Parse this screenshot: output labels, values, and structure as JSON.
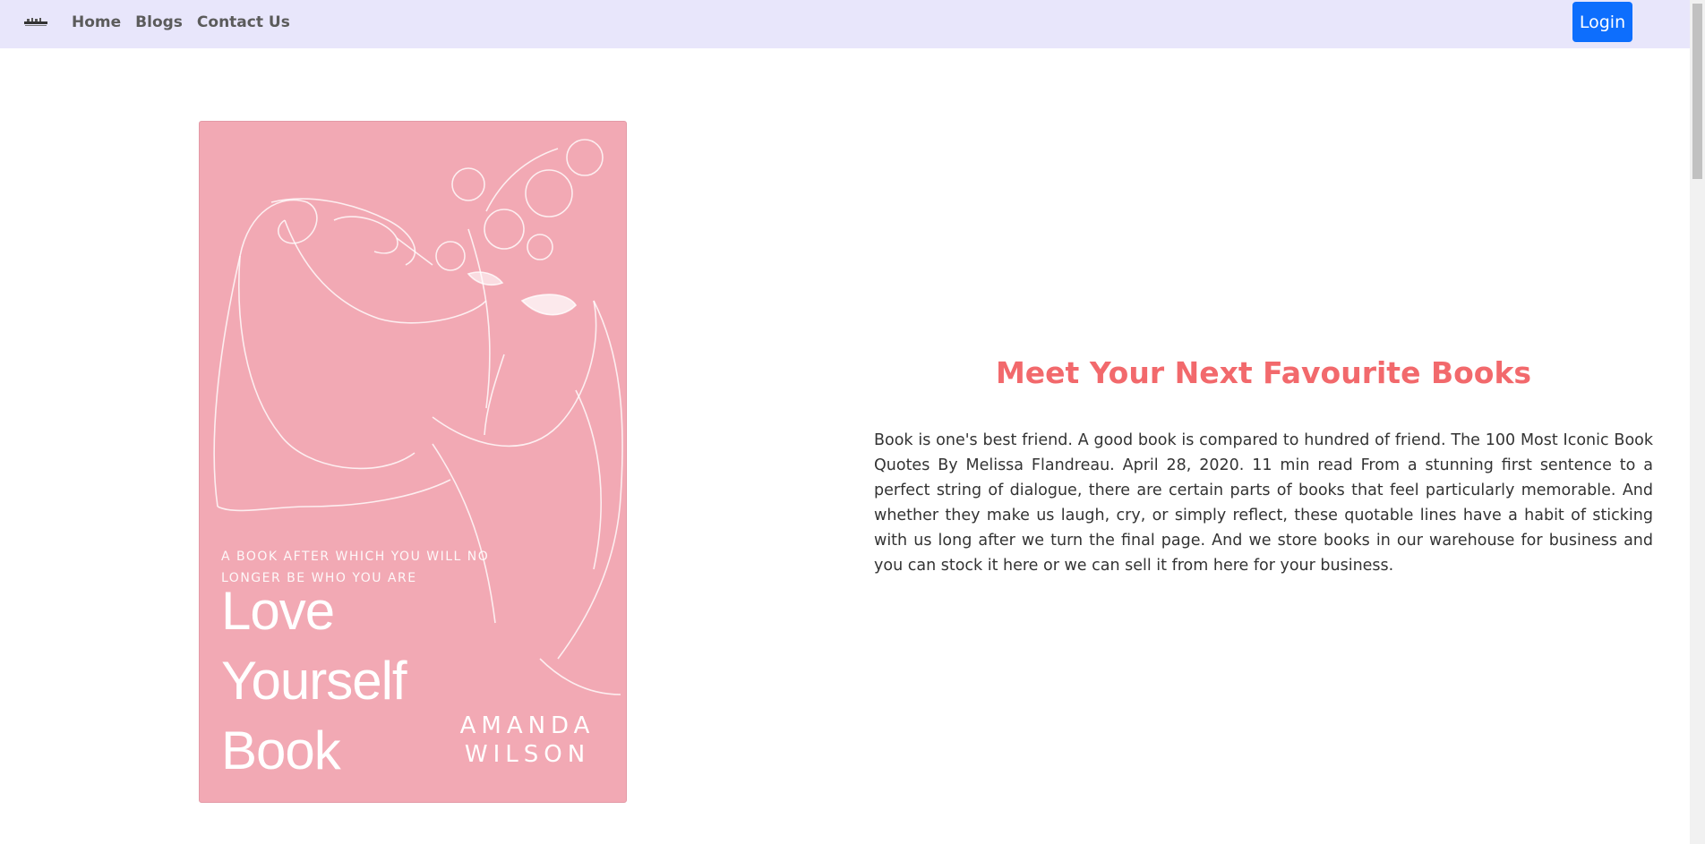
{
  "navbar": {
    "logo_icon": "book-stack-icon",
    "links": [
      "Home",
      "Blogs",
      "Contact Us"
    ],
    "login_label": "Login",
    "background": "#e8e6fb",
    "login_color": "#0d6efd"
  },
  "hero": {
    "cover": {
      "tagline": "A BOOK AFTER WHICH YOU WILL NO LONGER BE WHO YOU ARE",
      "title_lines": [
        "Love",
        "Yourself",
        "Book"
      ],
      "author_lines": [
        "AMANDA",
        "WILSON"
      ],
      "background": "#f2a9b4"
    },
    "heading": "Meet Your Next Favourite Books",
    "heading_color": "#f2696c",
    "description": "Book is one's best friend. A good book is compared to hundred of friend. The 100 Most Iconic Book Quotes By Melissa Flandreau. April 28, 2020. 11 min read From a stunning first sentence to a perfect string of dialogue, there are certain parts of books that feel particularly memorable. And whether they make us laugh, cry, or simply reflect, these quotable lines have a habit of sticking with us long after we turn the final page. And we store books in our warehouse for business and you can stock it here or we can sell it from here for your business."
  }
}
